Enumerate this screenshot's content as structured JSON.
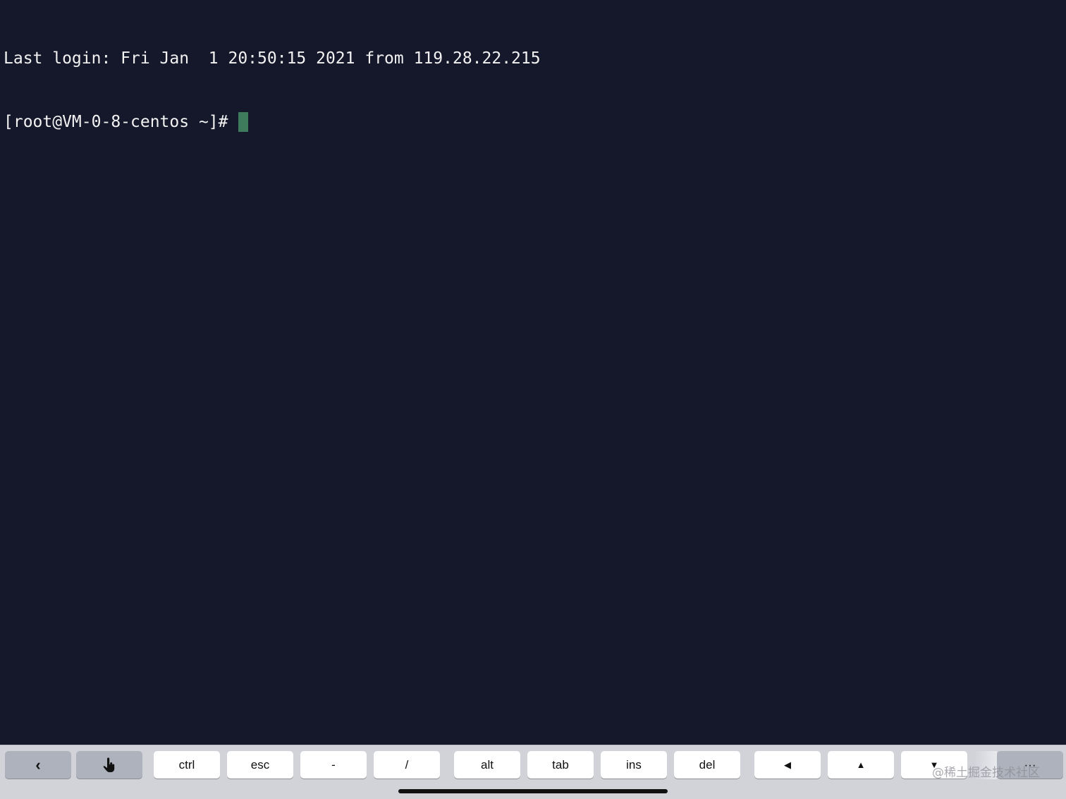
{
  "terminal": {
    "lines": [
      "Last login: Fri Jan  1 20:50:15 2021 from 119.28.22.215"
    ],
    "prompt": "[root@VM-0-8-centos ~]#",
    "cursor_color": "#3e7a5c",
    "background": "#15172a"
  },
  "keybar": {
    "back_icon": "chevron-left-icon",
    "touch_icon": "hand-pointer-icon",
    "keys": [
      "ctrl",
      "esc",
      "-",
      "/",
      "alt",
      "tab",
      "ins",
      "del"
    ],
    "arrow_left": "◀",
    "arrow_up": "▲",
    "arrow_down": "▼",
    "more": "···"
  },
  "watermark": "@稀土掘金技术社区"
}
